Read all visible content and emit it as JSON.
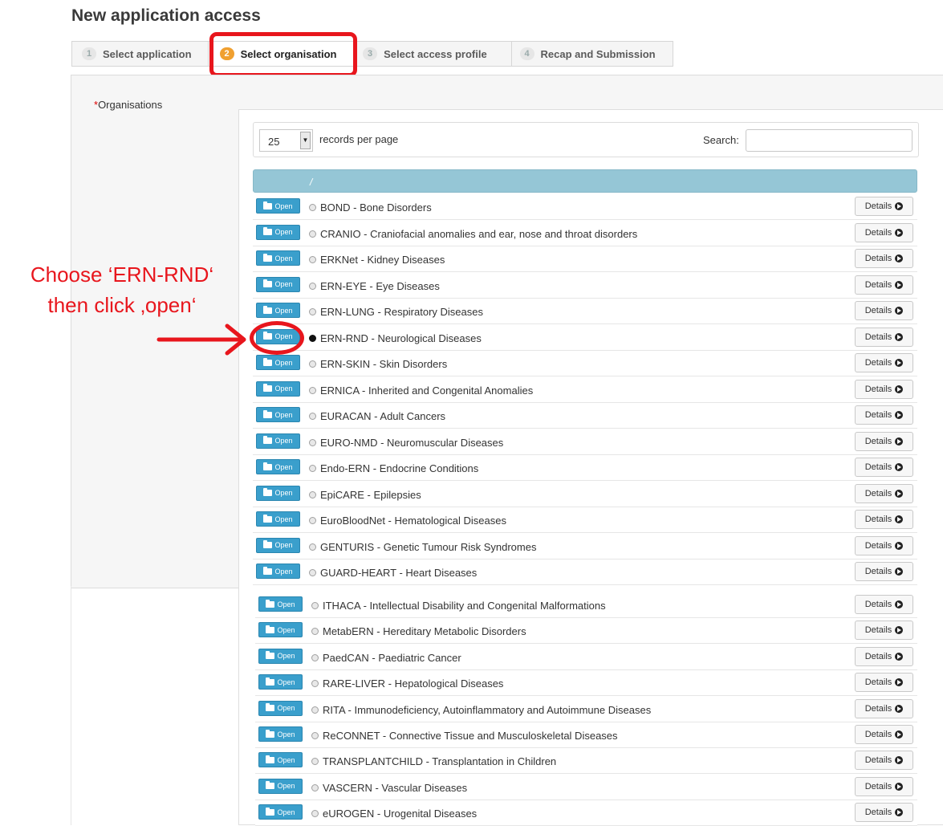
{
  "page": {
    "title": "New application access"
  },
  "wizard": {
    "steps": [
      {
        "number": "1",
        "label": "Select application",
        "active": false
      },
      {
        "number": "2",
        "label": "Select organisation",
        "active": true
      },
      {
        "number": "3",
        "label": "Select access profile",
        "active": false
      },
      {
        "number": "4",
        "label": "Recap and Submission",
        "active": false
      }
    ]
  },
  "form": {
    "required_mark": "*",
    "organisations_label": "Organisations"
  },
  "table": {
    "page_size": "25",
    "records_per_page_label": "records per page",
    "search_label": "Search:",
    "search_value": "",
    "header_text": "/",
    "open_label": "Open",
    "details_label": "Details",
    "rows": [
      {
        "label": "BOND - Bone Disorders",
        "selected": false
      },
      {
        "label": "CRANIO - Craniofacial anomalies and ear, nose and throat disorders",
        "selected": false
      },
      {
        "label": "ERKNet - Kidney Diseases",
        "selected": false
      },
      {
        "label": "ERN-EYE - Eye Diseases",
        "selected": false
      },
      {
        "label": "ERN-LUNG - Respiratory Diseases",
        "selected": false
      },
      {
        "label": "ERN-RND - Neurological Diseases",
        "selected": true
      },
      {
        "label": "ERN-SKIN - Skin Disorders",
        "selected": false
      },
      {
        "label": "ERNICA - Inherited and Congenital Anomalies",
        "selected": false
      },
      {
        "label": "EURACAN - Adult Cancers",
        "selected": false
      },
      {
        "label": "EURO-NMD - Neuromuscular Diseases",
        "selected": false
      },
      {
        "label": "Endo-ERN - Endocrine Conditions",
        "selected": false
      },
      {
        "label": "EpiCARE - Epilepsies",
        "selected": false
      },
      {
        "label": "EuroBloodNet - Hematological Diseases",
        "selected": false
      },
      {
        "label": "GENTURIS - Genetic Tumour Risk Syndromes",
        "selected": false
      },
      {
        "label": "GUARD-HEART - Heart Diseases",
        "selected": false
      },
      {
        "label": "ITHACA - Intellectual Disability and Congenital Malformations",
        "selected": false
      },
      {
        "label": "MetabERN - Hereditary Metabolic Disorders",
        "selected": false
      },
      {
        "label": "PaedCAN - Paediatric Cancer",
        "selected": false
      },
      {
        "label": "RARE-LIVER - Hepatological Diseases",
        "selected": false
      },
      {
        "label": "RITA - Immunodeficiency, Autoinflammatory and Autoimmune Diseases",
        "selected": false
      },
      {
        "label": "ReCONNET - Connective Tissue and Musculoskeletal Diseases",
        "selected": false
      },
      {
        "label": "TRANSPLANTCHILD - Transplantation in Children",
        "selected": false
      },
      {
        "label": "VASCERN - Vascular Diseases",
        "selected": false
      },
      {
        "label": "eUROGEN - Urogenital Diseases",
        "selected": false
      }
    ]
  },
  "annotation": {
    "line1": "Choose ‘ERN-RND‘",
    "line2": "then click ‚open‘",
    "color": "#e8161d"
  }
}
